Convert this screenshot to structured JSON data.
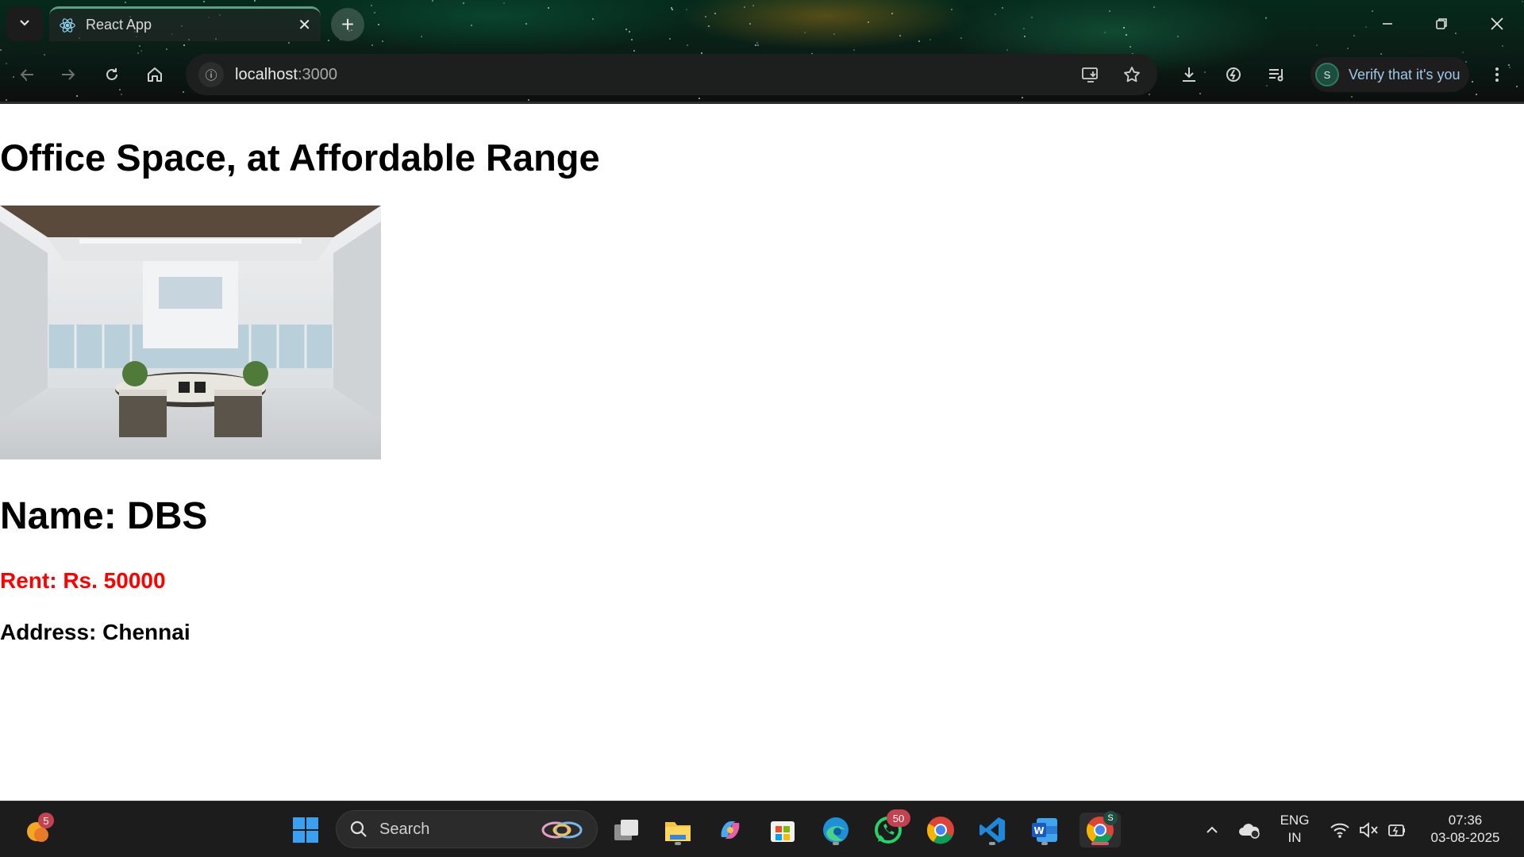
{
  "browser": {
    "tab_title": "React App",
    "url_host": "localhost",
    "url_port": ":3000",
    "verify_label": "Verify that it's you",
    "profile_initial": "S"
  },
  "page": {
    "heading": "Office Space, at Affordable Range",
    "name": "Name: DBS",
    "rent": "Rent: Rs. 50000",
    "address": "Address: Chennai",
    "colors": {
      "rent": "#ff0000",
      "text": "#000000"
    }
  },
  "taskbar": {
    "weather_badge": "5",
    "search_placeholder": "Search",
    "whatsapp_badge": "50",
    "chrome_profile_badge": "S",
    "language_top": "ENG",
    "language_bottom": "IN",
    "time": "07:36",
    "date": "03-08-2025"
  }
}
